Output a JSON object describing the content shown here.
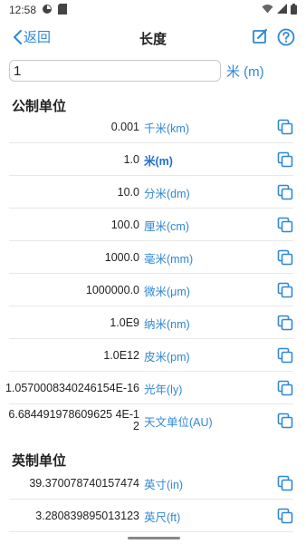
{
  "status": {
    "time": "12:58"
  },
  "nav": {
    "back_label": "返回",
    "title": "长度"
  },
  "input": {
    "value": "1",
    "unit": "米 (m)"
  },
  "metric": {
    "title": "公制单位",
    "rows": [
      {
        "value": "0.001",
        "unit": "千米(km)"
      },
      {
        "value": "1.0",
        "unit": "米(m)"
      },
      {
        "value": "10.0",
        "unit": "分米(dm)"
      },
      {
        "value": "100.0",
        "unit": "厘米(cm)"
      },
      {
        "value": "1000.0",
        "unit": "毫米(mm)"
      },
      {
        "value": "1000000.0",
        "unit": "微米(μm)"
      },
      {
        "value": "1.0E9",
        "unit": "纳米(nm)"
      },
      {
        "value": "1.0E12",
        "unit": "皮米(pm)"
      },
      {
        "value": "1.0570008340246154E-16",
        "unit": "光年(ly)"
      },
      {
        "value": "6.684491978609625 4E-12",
        "unit": "天文单位(AU)"
      }
    ]
  },
  "imperial": {
    "title": "英制单位",
    "rows": [
      {
        "value": "39.370078740157474",
        "unit": "英寸(in)"
      },
      {
        "value": "3.280839895013123",
        "unit": "英尺(ft)"
      }
    ]
  },
  "colors": {
    "accent": "#2f87d6",
    "divider": "#e8e8e8"
  }
}
